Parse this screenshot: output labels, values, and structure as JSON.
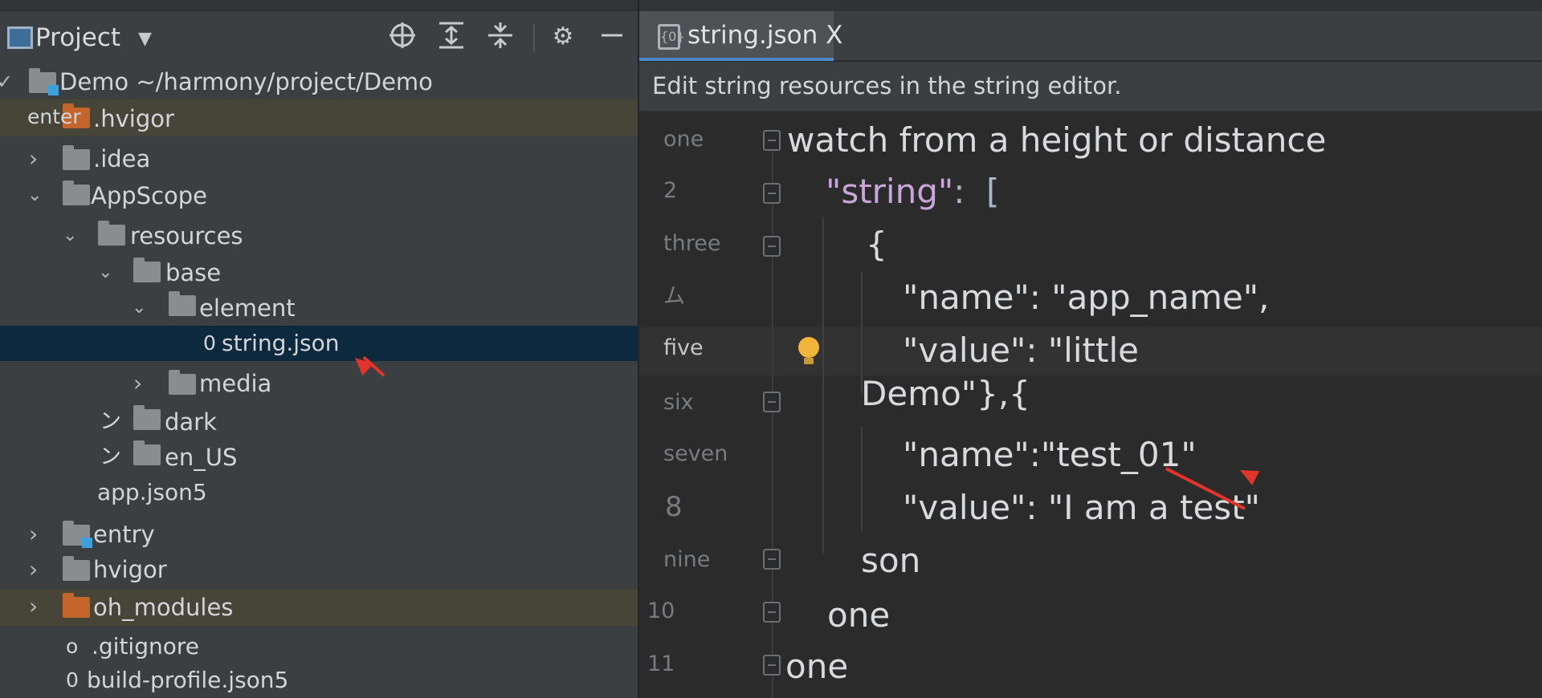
{
  "project_panel": {
    "title": "Project",
    "toolbar": [
      "locate-icon",
      "expand-all-icon",
      "collapse-all-icon",
      "gear-icon",
      "minimize-icon"
    ],
    "tree": [
      {
        "label": "Demo ~/harmony/project/Demo",
        "type": "project"
      },
      {
        "tag": "enter",
        "label": ".hvigor",
        "type": "folder-excluded"
      },
      {
        "label": ".idea",
        "type": "folder"
      },
      {
        "label": "AppScope",
        "type": "folder"
      },
      {
        "label": "resources",
        "type": "folder"
      },
      {
        "label": "base",
        "type": "folder"
      },
      {
        "label": "element",
        "type": "folder"
      },
      {
        "prefix": "0",
        "label": "string.json",
        "type": "file",
        "selected": true
      },
      {
        "label": "media",
        "type": "folder"
      },
      {
        "chevron": "ン",
        "label": "dark",
        "type": "folder"
      },
      {
        "chevron": "ン",
        "label": "en_US",
        "type": "folder"
      },
      {
        "label": "app.json5",
        "type": "file"
      },
      {
        "label": "entry",
        "type": "module"
      },
      {
        "label": "hvigor",
        "type": "folder"
      },
      {
        "label": "oh_modules",
        "type": "folder-excluded"
      },
      {
        "prefix": "o",
        "label": ".gitignore",
        "type": "file"
      },
      {
        "prefix": "0",
        "label": "build-profile.json5",
        "type": "file"
      }
    ]
  },
  "editor": {
    "tab_label": "string.json X",
    "tab_icon": "{0}",
    "banner": "Edit string resources in the string editor.",
    "line_numbers": [
      "one",
      "2",
      "three",
      "ム",
      "five",
      "six",
      "seven",
      "8",
      "nine",
      "10",
      "11"
    ],
    "lines": {
      "l1": "watch from a height or distance",
      "l2_str": "\"string\"",
      "l2_rest": ":  [",
      "l3": "{",
      "l4": "\"name\": \"app_name\",",
      "l5": "\"value\": \"little",
      "l5b": "Demo\"},{",
      "l7": "\"name\":\"test_01\"",
      "l8": "\"value\": \"I am a test\"",
      "l9": "son",
      "l10": "one",
      "l11": "one"
    }
  },
  "colors": {
    "annotation_arrow": "#e3342b",
    "selection": "#0d293e",
    "excluded_highlight": "#474538",
    "tab_underline": "#4a88c7"
  }
}
